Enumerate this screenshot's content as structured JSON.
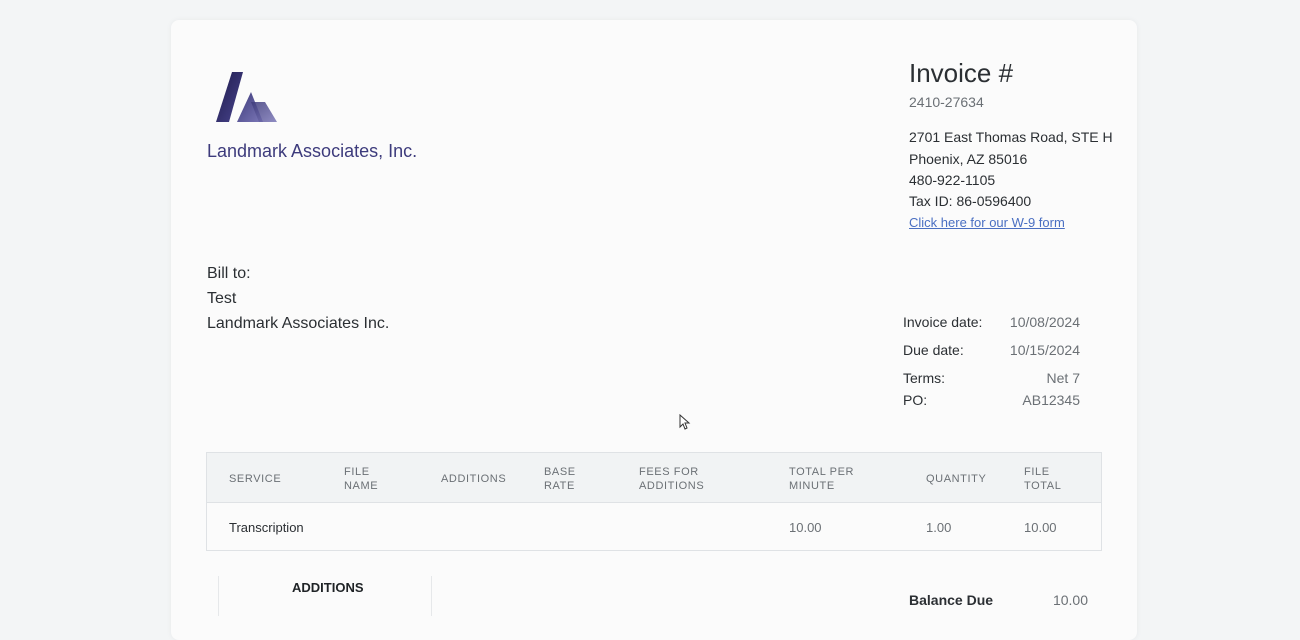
{
  "company": {
    "name": "Landmark Associates, Inc."
  },
  "invoice": {
    "title": "Invoice #",
    "number": "2410-27634",
    "address_line1": "2701 East Thomas Road, STE H",
    "address_line2": "Phoenix, AZ 85016",
    "phone": "480-922-1105",
    "tax_id": "Tax ID: 86-0596400",
    "w9_link": "Click here for our W-9 form"
  },
  "bill_to": {
    "label": "Bill to:",
    "name": "Test",
    "company": "Landmark Associates Inc."
  },
  "meta": {
    "invoice_date_label": "Invoice date:",
    "invoice_date": "10/08/2024",
    "due_date_label": "Due date:",
    "due_date": "10/15/2024",
    "terms_label": "Terms:",
    "terms": "Net 7",
    "po_label": "PO:",
    "po": "AB12345"
  },
  "table": {
    "headers": {
      "service": "SERVICE",
      "file_name_1": "FILE",
      "file_name_2": "NAME",
      "additions": "ADDITIONS",
      "base_rate_1": "BASE",
      "base_rate_2": "RATE",
      "fees_1": "FEES FOR",
      "fees_2": "ADDITIONS",
      "total_per_minute_1": "TOTAL PER",
      "total_per_minute_2": "MINUTE",
      "quantity": "QUANTITY",
      "file_total_1": "FILE",
      "file_total_2": "TOTAL"
    },
    "rows": [
      {
        "service": "Transcription",
        "file_name": "",
        "additions": "",
        "base_rate": "",
        "fees": "",
        "total_per_minute": "10.00",
        "quantity": "1.00",
        "file_total": "10.00"
      }
    ]
  },
  "additions_section": {
    "title": "ADDITIONS"
  },
  "balance": {
    "label": "Balance Due",
    "value": "10.00"
  },
  "colors": {
    "brand": "#3d3b7c",
    "link": "#4a6fc2"
  }
}
